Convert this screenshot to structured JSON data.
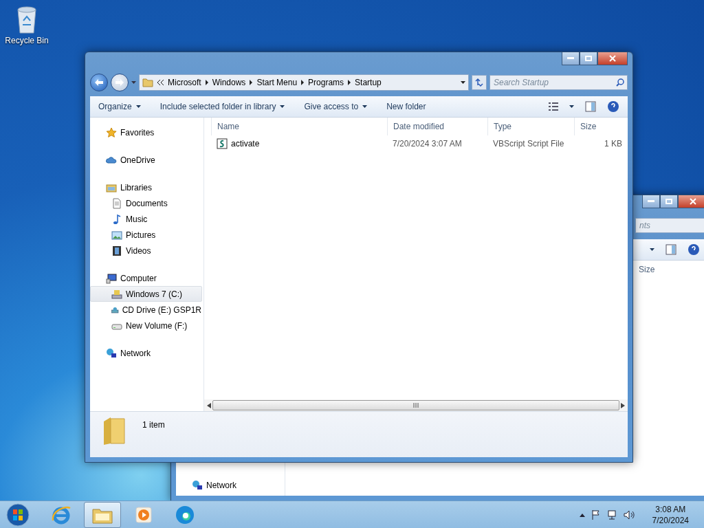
{
  "desktop_icons": [
    {
      "label": "Recycle Bin"
    }
  ],
  "back_window": {
    "search": {
      "placeholder": "nts"
    },
    "columns": [
      "Size"
    ],
    "nav_items": [
      {
        "label": "Network",
        "selected": false
      }
    ]
  },
  "window": {
    "breadcrumb": [
      "Microsoft",
      "Windows",
      "Start Menu",
      "Programs",
      "Startup"
    ],
    "search": {
      "placeholder": "Search Startup"
    },
    "toolbar": [
      {
        "label": "Organize",
        "kind": "menu"
      },
      {
        "label": "Include selected folder in library",
        "kind": "menu"
      },
      {
        "label": "Give access to",
        "kind": "menu"
      },
      {
        "label": "New folder",
        "kind": "button"
      }
    ],
    "nav": [
      {
        "label": "Favorites",
        "kind": "star",
        "selected": false
      },
      {
        "label": "OneDrive",
        "kind": "cloud",
        "selected": false
      },
      {
        "label": "Libraries",
        "kind": "library",
        "selected": false,
        "children": [
          {
            "label": "Documents",
            "kind": "document",
            "selected": false
          },
          {
            "label": "Music",
            "kind": "music",
            "selected": false
          },
          {
            "label": "Pictures",
            "kind": "picture",
            "selected": false
          },
          {
            "label": "Videos",
            "kind": "video",
            "selected": false
          }
        ]
      },
      {
        "label": "Computer",
        "kind": "computer",
        "selected": false,
        "children": [
          {
            "label": "Windows 7 (C:)",
            "kind": "drive",
            "selected": true
          },
          {
            "label": "CD Drive (E:) GSP1R",
            "kind": "cd",
            "selected": false
          },
          {
            "label": "New Volume (F:)",
            "kind": "disk",
            "selected": false
          }
        ]
      },
      {
        "label": "Network",
        "kind": "network",
        "selected": false
      }
    ],
    "columns": [
      "Name",
      "Date modified",
      "Type",
      "Size"
    ],
    "files": [
      {
        "name": "activate",
        "date": "7/20/2024 3:07 AM",
        "type": "VBScript Script File",
        "size": "1 KB",
        "selected": false
      }
    ],
    "status": "1 item"
  },
  "taskbar": {
    "apps": [
      {
        "kind": "ie",
        "selected": false
      },
      {
        "kind": "explorer",
        "selected": true
      },
      {
        "kind": "media",
        "selected": false
      },
      {
        "kind": "edge",
        "selected": false
      }
    ],
    "clock": {
      "time": "3:08 AM",
      "date": "7/20/2024"
    }
  }
}
